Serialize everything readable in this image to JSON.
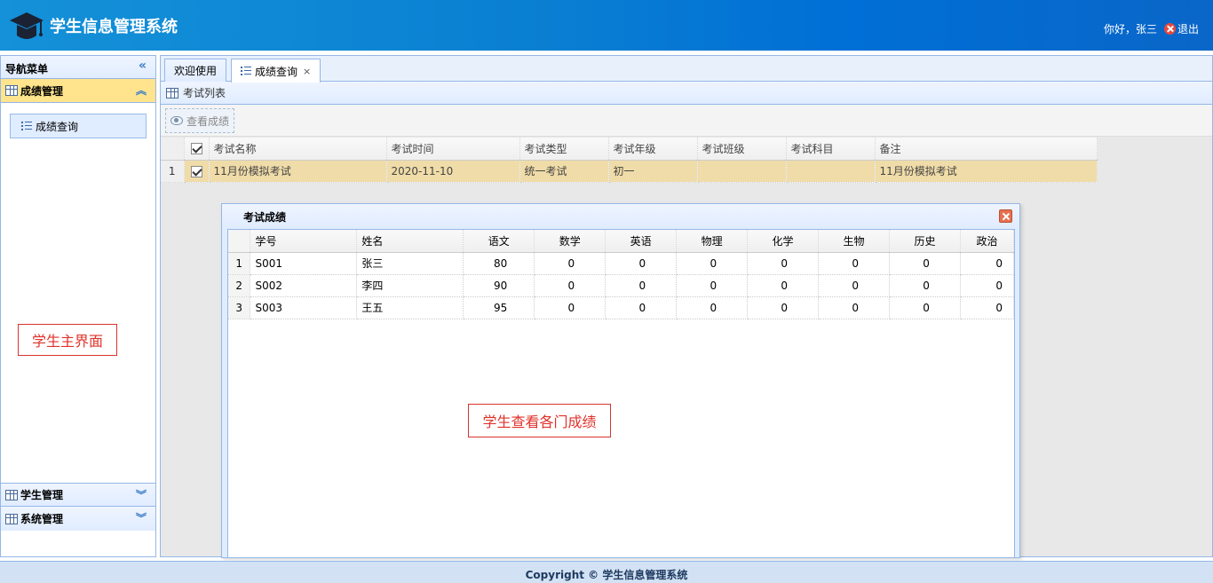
{
  "header": {
    "title": "学生信息管理系统",
    "greeting": "你好，张三",
    "logout": "退出"
  },
  "sidebar": {
    "title": "导航菜单",
    "sections": [
      {
        "label": "成绩管理",
        "items": [
          {
            "label": "成绩查询"
          }
        ]
      },
      {
        "label": "学生管理"
      },
      {
        "label": "系统管理"
      }
    ]
  },
  "notes": {
    "student_main": "学生主界面",
    "view_scores": "学生查看各门成绩"
  },
  "tabs": [
    {
      "label": "欢迎使用"
    },
    {
      "label": "成绩查询",
      "close": "×"
    }
  ],
  "panel": {
    "title": "考试列表",
    "view_button": "查看成绩"
  },
  "exam_table": {
    "columns": [
      "考试名称",
      "考试时间",
      "考试类型",
      "考试年级",
      "考试班级",
      "考试科目",
      "备注"
    ],
    "rows": [
      {
        "num": "1",
        "name": "11月份模拟考试",
        "time": "2020-11-10",
        "type": "统一考试",
        "grade": "初一",
        "class": "",
        "subject": "",
        "remark": "11月份模拟考试"
      }
    ]
  },
  "dialog": {
    "title": "考试成绩",
    "columns": [
      "学号",
      "姓名",
      "语文",
      "数学",
      "英语",
      "物理",
      "化学",
      "生物",
      "历史",
      "政治"
    ],
    "rows": [
      {
        "num": "1",
        "id": "S001",
        "name": "张三",
        "scores": [
          "80",
          "0",
          "0",
          "0",
          "0",
          "0",
          "0",
          "0"
        ]
      },
      {
        "num": "2",
        "id": "S002",
        "name": "李四",
        "scores": [
          "90",
          "0",
          "0",
          "0",
          "0",
          "0",
          "0",
          "0"
        ]
      },
      {
        "num": "3",
        "id": "S003",
        "name": "王五",
        "scores": [
          "95",
          "0",
          "0",
          "0",
          "0",
          "0",
          "0",
          "0"
        ]
      }
    ]
  },
  "footer": {
    "copyright": "Copyright © 学生信息管理系统"
  },
  "colors": {
    "header_start": "#1491d8",
    "header_end": "#0a66c8",
    "selected_row": "#f0dca8",
    "active_section": "#ffe48d"
  }
}
